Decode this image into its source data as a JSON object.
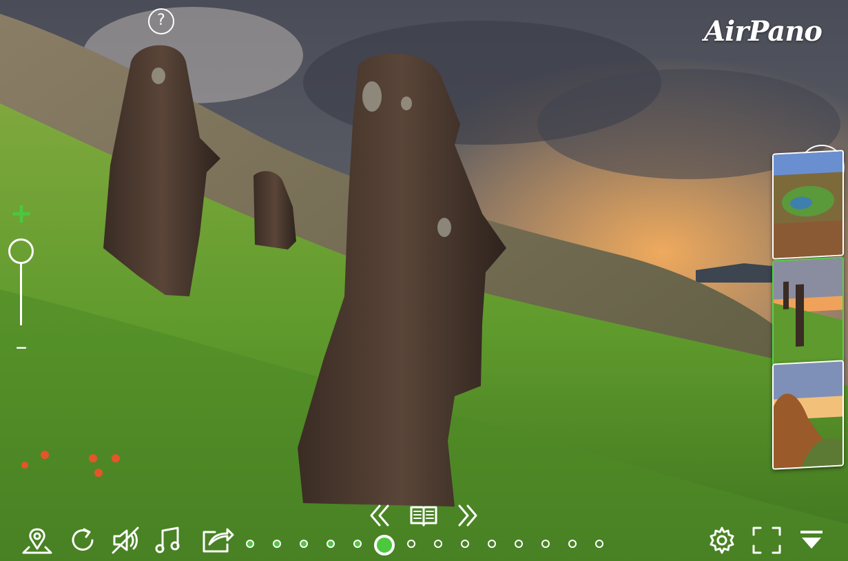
{
  "brand": {
    "logo_text": "AirPano"
  },
  "help": {
    "label": "?"
  },
  "zoom": {
    "plus_label": "+",
    "minus_label": "–",
    "level": 0.3
  },
  "accent_color": "#4cc83e",
  "thumbnails": [
    {
      "name": "crater-lake-thumbnail",
      "active": false
    },
    {
      "name": "moai-thumbnail",
      "active": true
    },
    {
      "name": "cliff-sunset-thumbnail",
      "active": false
    }
  ],
  "toolbar": {
    "left_icons": [
      "map-pin-icon",
      "rotate-icon",
      "mute-icon",
      "music-icon",
      "share-icon"
    ],
    "right_icons": [
      "settings-icon",
      "fullscreen-icon",
      "collapse-icon"
    ],
    "nav_icons": [
      "previous-icon",
      "book-icon",
      "next-icon"
    ]
  },
  "pager": {
    "total": 14,
    "current_index": 5,
    "visited_count": 5
  }
}
